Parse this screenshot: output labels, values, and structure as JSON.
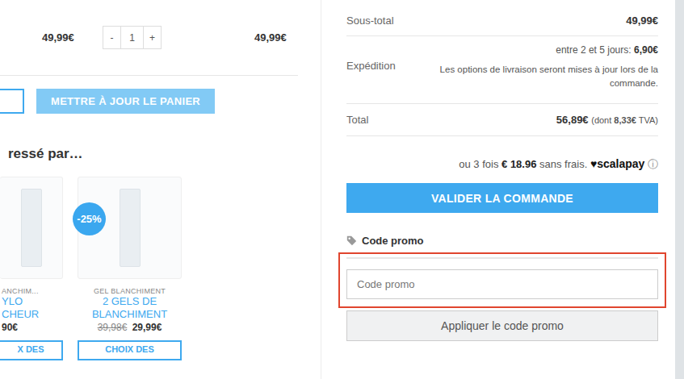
{
  "cart_row": {
    "price": "49,99€",
    "minus": "-",
    "quantity": "1",
    "plus": "+",
    "total": "49,99€"
  },
  "update_button": "METTRE À JOUR LE PANIER",
  "related": {
    "heading": "ressé par…",
    "products": [
      {
        "category": "ANCHIM...",
        "name_lines": [
          "YLO",
          "CHEUR"
        ],
        "old_price": null,
        "price": "90€",
        "button": "X DES",
        "discount": null
      },
      {
        "category": "GEL BLANCHIMENT",
        "name_lines": [
          "2 GELS DE",
          "BLANCHIMENT"
        ],
        "old_price": "39,98€",
        "price": "29,99€",
        "button": "CHOIX DES",
        "discount": "-25%"
      }
    ]
  },
  "totals": {
    "subtotal_label": "Sous-total",
    "subtotal": "49,99€",
    "shipping_label": "Expédition",
    "shipping_option": "entre 2 et 5 jours: ",
    "shipping_price": "6,90€",
    "shipping_note": "Les options de livraison seront mises à jour lors de la commande.",
    "total_label": "Total",
    "total": "56,89€",
    "tax_open": "(dont ",
    "tax": "8,33€",
    "tax_close": " TVA)"
  },
  "installments": {
    "prefix": "ou 3 fois",
    "amount": "€ 18.96",
    "suffix": "sans frais.",
    "heart": "♥",
    "brand": "scalapay",
    "info": "ⓘ"
  },
  "checkout_button": "VALIDER LA COMMANDE",
  "promo": {
    "heading": "Code promo",
    "placeholder": "Code promo",
    "apply_button": "Appliquer le code promo"
  }
}
